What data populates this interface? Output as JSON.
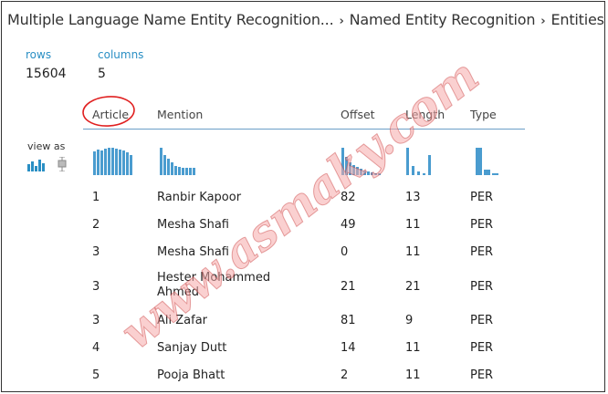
{
  "breadcrumb": {
    "items": [
      "Multiple Language Name Entity Recognition...",
      "Named Entity Recognition",
      "Entities"
    ],
    "separator": "›"
  },
  "stats": {
    "rows_label": "rows",
    "rows_value": "15604",
    "columns_label": "columns",
    "columns_value": "5"
  },
  "view_as_label": "view as",
  "columns": [
    "Article",
    "Mention",
    "Offset",
    "Length",
    "Type"
  ],
  "rows": [
    {
      "article": "1",
      "mention": "Ranbir Kapoor",
      "offset": "82",
      "length": "13",
      "type": "PER"
    },
    {
      "article": "2",
      "mention": "Mesha Shafi",
      "offset": "49",
      "length": "11",
      "type": "PER"
    },
    {
      "article": "3",
      "mention": "Mesha Shafi",
      "offset": "0",
      "length": "11",
      "type": "PER"
    },
    {
      "article": "3",
      "mention": "Hester Mohammed Ahmed",
      "offset": "21",
      "length": "21",
      "type": "PER"
    },
    {
      "article": "3",
      "mention": "Ali Zafar",
      "offset": "81",
      "length": "9",
      "type": "PER"
    },
    {
      "article": "4",
      "mention": "Sanjay Dutt",
      "offset": "14",
      "length": "11",
      "type": "PER"
    },
    {
      "article": "5",
      "mention": "Pooja Bhatt",
      "offset": "2",
      "length": "11",
      "type": "PER"
    }
  ],
  "watermark": "www.asmaky.com",
  "colors": {
    "accent": "#2a8fc4",
    "bar": "#4a9ccf",
    "annotation": "#e02020"
  }
}
